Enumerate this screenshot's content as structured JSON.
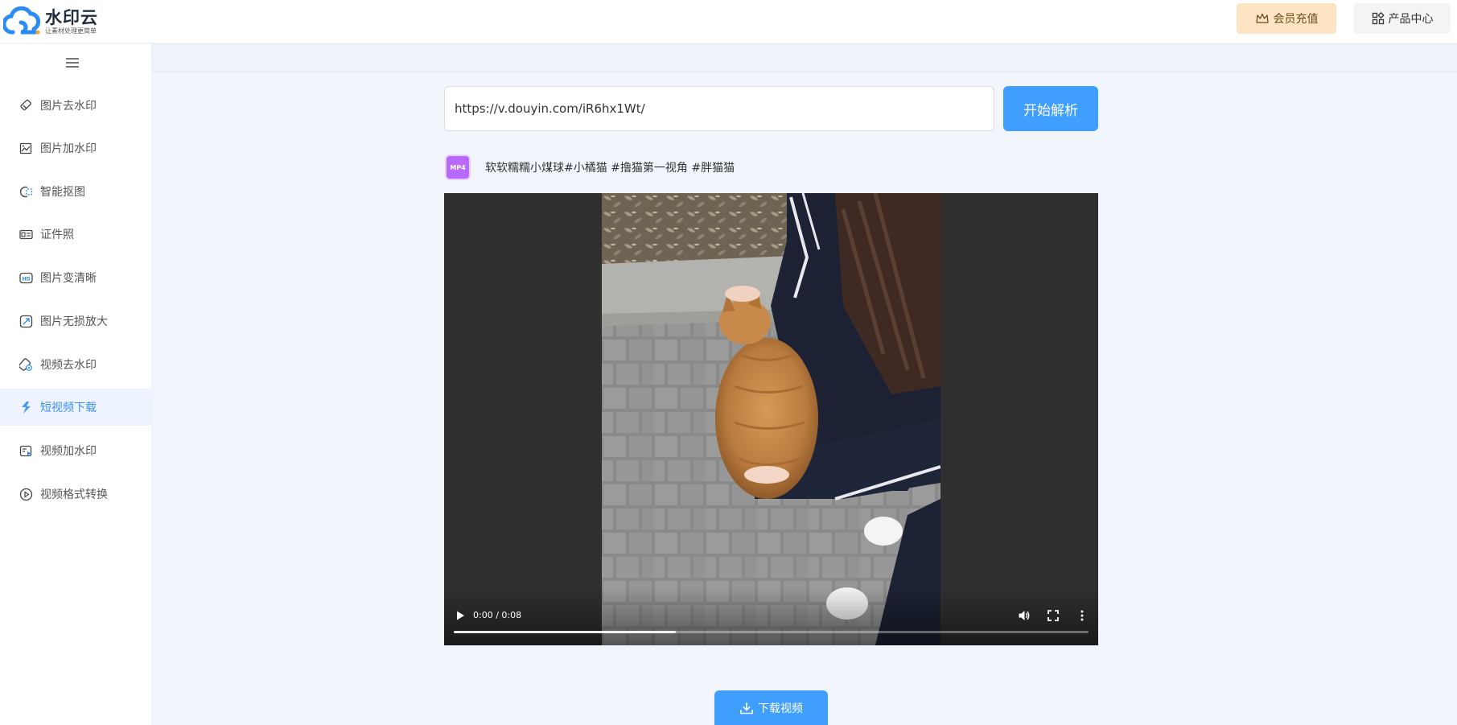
{
  "brand": {
    "name": "水印云",
    "slogan": "让素材处理更简单",
    "accent": "#409eff"
  },
  "header": {
    "vip_label": "会员充值",
    "vip_icon": "crown-icon",
    "products_label": "产品中心",
    "products_icon": "grid-icon"
  },
  "sidebar": {
    "toggle_icon": "menu-icon",
    "items": [
      {
        "label": "图片去水印",
        "icon": "eraser-icon",
        "active": false
      },
      {
        "label": "图片加水印",
        "icon": "image-edit-icon",
        "active": false
      },
      {
        "label": "智能抠图",
        "icon": "cutout-icon",
        "active": false
      },
      {
        "label": "证件照",
        "icon": "id-card-icon",
        "active": false
      },
      {
        "label": "图片变清晰",
        "icon": "hd-icon",
        "active": false
      },
      {
        "label": "图片无损放大",
        "icon": "enlarge-icon",
        "active": false
      },
      {
        "label": "视频去水印",
        "icon": "video-eraser-icon",
        "active": false
      },
      {
        "label": "短视频下载",
        "icon": "short-video-icon",
        "active": true
      },
      {
        "label": "视频加水印",
        "icon": "video-watermark-icon",
        "active": false
      },
      {
        "label": "视频格式转换",
        "icon": "convert-icon",
        "active": false
      }
    ]
  },
  "parser": {
    "url_value": "https://v.douyin.com/iR6hx1Wt/",
    "parse_label": "开始解析"
  },
  "result": {
    "format_badge": "MP4",
    "title": "软软糯糯小煤球#小橘猫 #撸猫第一视角 #胖猫猫"
  },
  "player": {
    "time": "0:00 / 0:08",
    "progress": 0.35,
    "play_icon": "play-icon",
    "volume_icon": "volume-icon",
    "fullscreen_icon": "fullscreen-icon",
    "more_icon": "more-vertical-icon"
  },
  "download": {
    "label": "下载视频",
    "icon": "download-icon"
  }
}
